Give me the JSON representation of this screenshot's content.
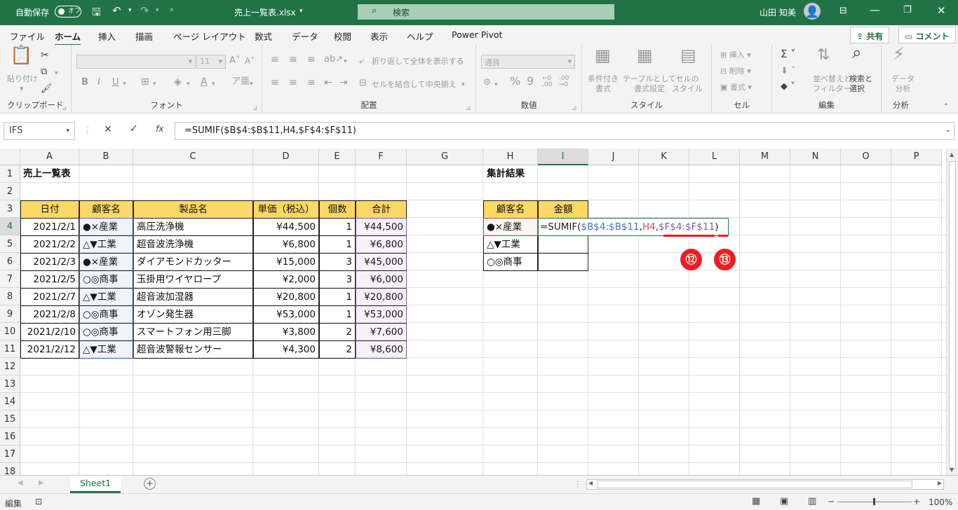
{
  "titlebar": {
    "autosave": "自動保存",
    "toggle": "オフ",
    "filename": "売上一覧表.xlsx",
    "search": "検索",
    "user": "山田 知美"
  },
  "tabs": [
    "ファイル",
    "ホーム",
    "挿入",
    "描画",
    "ページ レイアウト",
    "数式",
    "データ",
    "校閲",
    "表示",
    "ヘルプ",
    "Power Pivot"
  ],
  "share": "共有",
  "comment": "コメント",
  "ribbon": {
    "clipboard": {
      "label": "クリップボード",
      "paste": "貼り付け"
    },
    "font": {
      "label": "フォント",
      "size": "11"
    },
    "align": {
      "label": "配置",
      "wrap": "折り返して全体を表示する",
      "merge": "セルを結合して中央揃え"
    },
    "number": {
      "label": "数値",
      "format": "通貨"
    },
    "style": {
      "label": "スタイル",
      "cond": "条件付き\n書式",
      "table": "テーブルとして\n書式設定",
      "cellstyle": "セルの\nスタイル"
    },
    "cells": {
      "label": "セル",
      "insert": "挿入",
      "delete": "削除",
      "format": "書式"
    },
    "edit": {
      "label": "編集",
      "sort": "並べ替えと\nフィルター",
      "find": "検索と\n選択"
    },
    "analysis": {
      "label": "分析",
      "data": "データ\n分析"
    }
  },
  "namebox": "IFS",
  "formula": "=SUMIF($B$4:$B$11,H4,$F$4:$F$11)",
  "columns": [
    "A",
    "B",
    "C",
    "D",
    "E",
    "F",
    "G",
    "H",
    "I",
    "J",
    "K",
    "L",
    "M",
    "N",
    "O",
    "P"
  ],
  "rows": [
    "1",
    "2",
    "3",
    "4",
    "5",
    "6",
    "7",
    "8",
    "9",
    "10",
    "11",
    "12",
    "13",
    "14",
    "15",
    "16",
    "17",
    "18"
  ],
  "sheet": {
    "title": "売上一覧表",
    "headers": [
      "日付",
      "顧客名",
      "製品名",
      "単価（税込）",
      "個数",
      "合計"
    ],
    "data": [
      [
        "2021/2/1",
        "●×産業",
        "高圧洗浄機",
        "¥44,500",
        "1",
        "¥44,500"
      ],
      [
        "2021/2/2",
        "△▼工業",
        "超音波洗浄機",
        "¥6,800",
        "1",
        "¥6,800"
      ],
      [
        "2021/2/3",
        "●×産業",
        "ダイアモンドカッター",
        "¥15,000",
        "3",
        "¥45,000"
      ],
      [
        "2021/2/5",
        "○◎商事",
        "玉掛用ワイヤロープ",
        "¥2,000",
        "3",
        "¥6,000"
      ],
      [
        "2021/2/7",
        "△▼工業",
        "超音波加湿器",
        "¥20,800",
        "1",
        "¥20,800"
      ],
      [
        "2021/2/8",
        "○◎商事",
        "オゾン発生器",
        "¥53,000",
        "1",
        "¥53,000"
      ],
      [
        "2021/2/10",
        "○◎商事",
        "スマートフォン用三脚",
        "¥3,800",
        "2",
        "¥7,600"
      ],
      [
        "2021/2/12",
        "△▼工業",
        "超音波警報センサー",
        "¥4,300",
        "2",
        "¥8,600"
      ]
    ],
    "summary_title": "集計結果",
    "summary_headers": [
      "顧客名",
      "金額"
    ],
    "summary_rows": [
      "●×産業",
      "△▼工業",
      "○◎商事"
    ],
    "edit": {
      "prefix": "=SUMIF(",
      "arg1": "$B$4:$B$11",
      ",": ",",
      "arg2": "H4",
      "arg3": "$F$4:$F$11",
      "close": ")"
    }
  },
  "annotations": [
    "⑫",
    "⑬"
  ],
  "sheet_tab": "Sheet1",
  "status": {
    "mode": "編集",
    "zoom": "100%"
  }
}
